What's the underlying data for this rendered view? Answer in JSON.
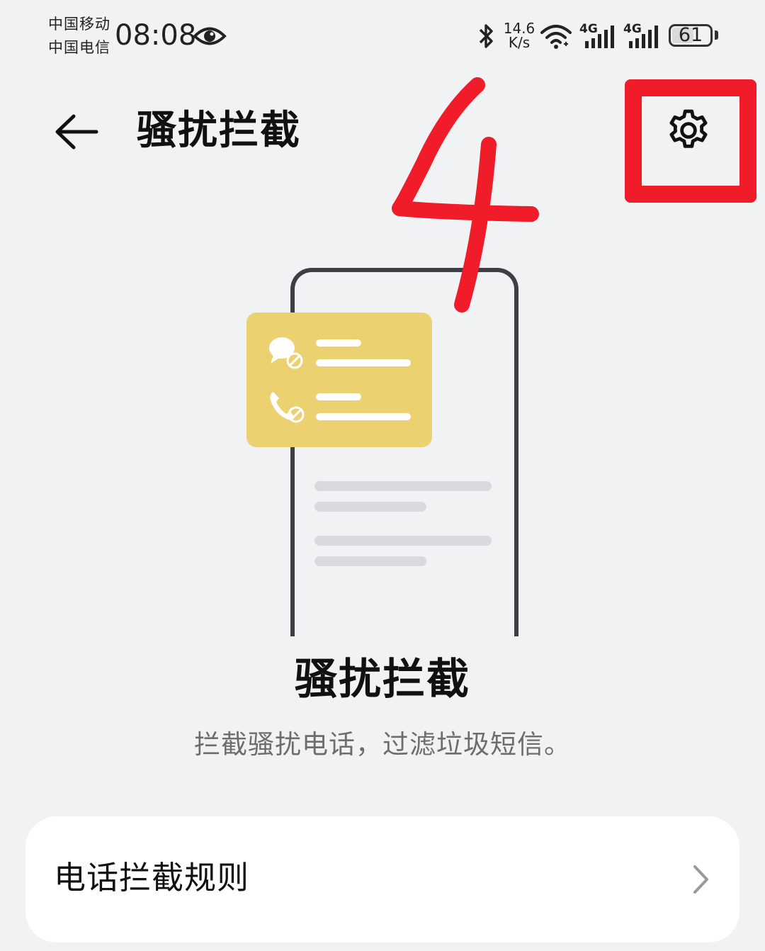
{
  "status_bar": {
    "carrier_1": "中国移动",
    "carrier_2": "中国电信",
    "time": "08:08",
    "net_speed_value": "14.6",
    "net_speed_unit": "K/s",
    "sim1_network": "4G",
    "sim2_network": "4G",
    "battery_percent": "61",
    "battery_level": 0.61
  },
  "header": {
    "title": "骚扰拦截",
    "back_icon": "arrow-left-icon",
    "settings_icon": "gear-icon"
  },
  "hero": {
    "title": "骚扰拦截",
    "subtitle": "拦截骚扰电话，过滤垃圾短信。"
  },
  "menu": {
    "items": [
      {
        "label": "电话拦截规则",
        "icon": "chevron-right-icon"
      }
    ]
  },
  "annotation": {
    "step_number": "4",
    "color": "#f01c2a"
  },
  "colors": {
    "background": "#f1f2f4",
    "card_yellow": "#ecd170",
    "annotation_red": "#f01c2a"
  }
}
